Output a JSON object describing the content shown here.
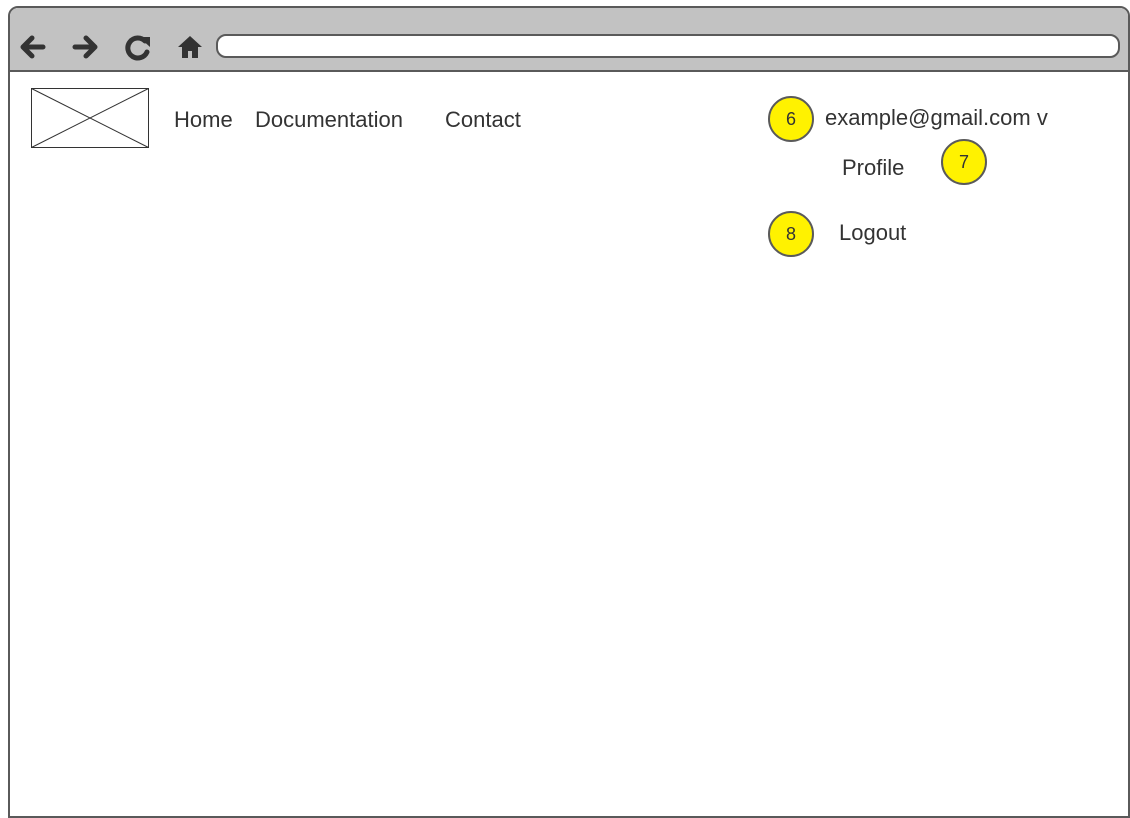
{
  "browser": {
    "back_icon": "arrow-left-icon",
    "forward_icon": "arrow-right-icon",
    "reload_icon": "refresh-icon",
    "home_icon": "home-icon",
    "address_value": ""
  },
  "logo": {
    "icon": "image-placeholder-icon"
  },
  "nav": {
    "items": [
      {
        "label": "Home"
      },
      {
        "label": "Documentation"
      },
      {
        "label": "Contact"
      }
    ]
  },
  "account": {
    "email_label": "example@gmail.com v",
    "profile_label": "Profile",
    "logout_label": "Logout"
  },
  "annotations": {
    "badges": [
      "6",
      "7",
      "8"
    ],
    "color": "#fff200"
  }
}
